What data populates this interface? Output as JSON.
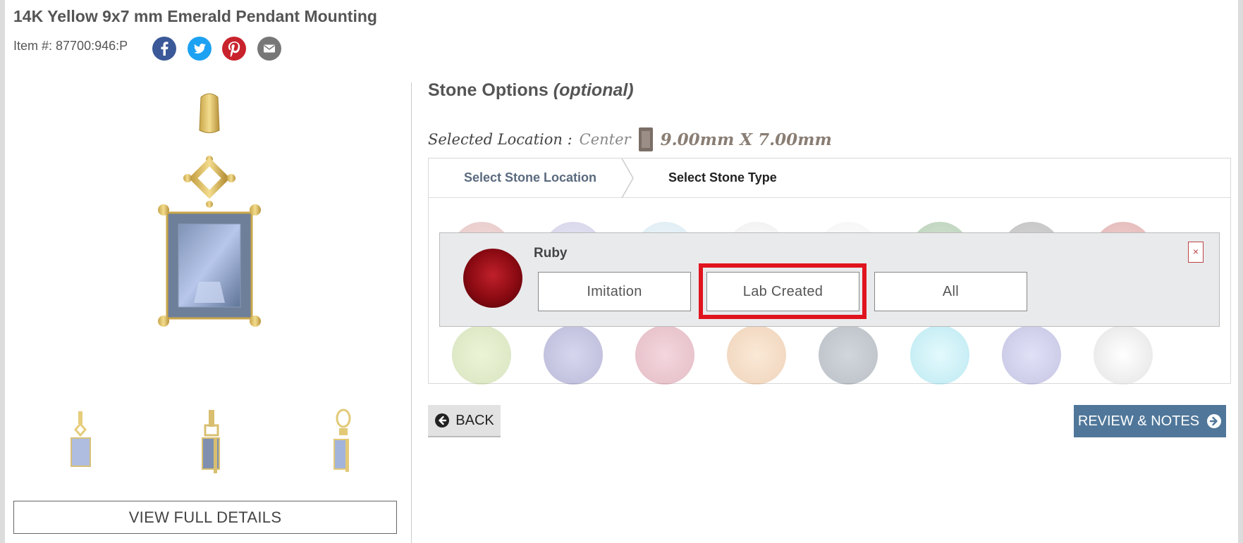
{
  "product": {
    "title": "14K Yellow 9x7 mm Emerald Pendant Mounting",
    "item_number": "Item #: 87700:946:P",
    "share_icons": [
      "facebook-icon",
      "twitter-icon",
      "pinterest-icon",
      "email-icon"
    ]
  },
  "gallery": {
    "view_full_details_label": "VIEW FULL DETAILS"
  },
  "stone_options": {
    "heading": "Stone Options",
    "heading_suffix": "(optional)",
    "selected_location_label": "Selected Location :",
    "selected_location_value": "Center",
    "selected_size": "9.00mm X 7.00mm"
  },
  "steps": {
    "step1_label": "Select Stone Location",
    "step2_label": "Select Stone Type"
  },
  "stone_popup": {
    "stone_name": "Ruby",
    "options": [
      "Imitation",
      "Lab Created",
      "All"
    ],
    "highlighted_option": "Lab Created",
    "close_label": "×"
  },
  "nav": {
    "back_label": "BACK",
    "review_label": "REVIEW & NOTES"
  },
  "colors": {
    "highlight": "#e0141e",
    "review_button": "#50779a",
    "facebook": "#3b5998",
    "twitter": "#1da1f2",
    "pinterest": "#c8232c",
    "email": "#777777"
  }
}
